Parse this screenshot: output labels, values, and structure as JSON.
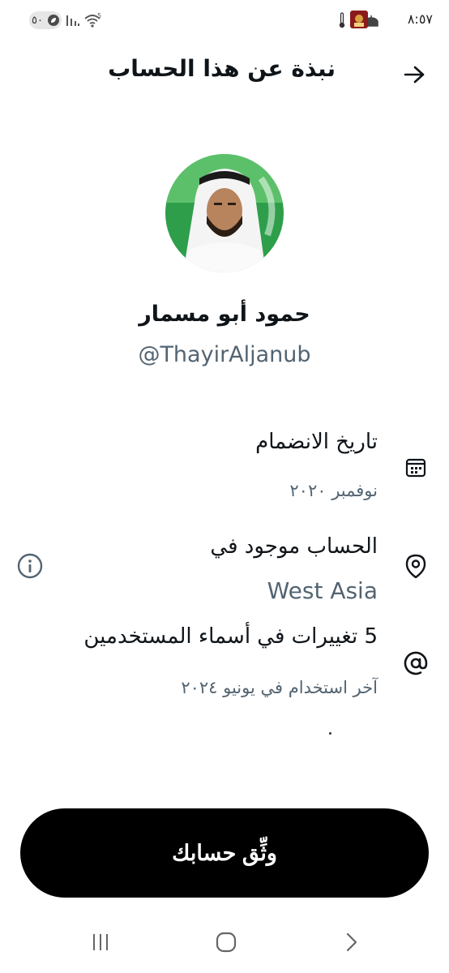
{
  "status_bar": {
    "time": "٨:٥٧",
    "battery_level": "٥٠",
    "network": "5"
  },
  "header": {
    "title": "نبذة عن هذا الحساب"
  },
  "profile": {
    "display_name": "حمود أبو مسمار",
    "handle": "@ThayirAljanub"
  },
  "details": {
    "joined_label": "تاريخ الانضمام",
    "joined_value": "نوفمبر ٢٠٢٠",
    "location_label": "الحساب موجود في",
    "location_value": "West Asia",
    "username_changes_label": "5 تغييرات في أسماء المستخدمين",
    "username_changes_value": "آخر استخدام في يونيو ٢٠٢٤"
  },
  "verify_button": {
    "label": "وثِّق حسابك"
  },
  "colors": {
    "primary_text": "#0f1419",
    "secondary_text": "#536471",
    "button_bg": "#000000"
  }
}
